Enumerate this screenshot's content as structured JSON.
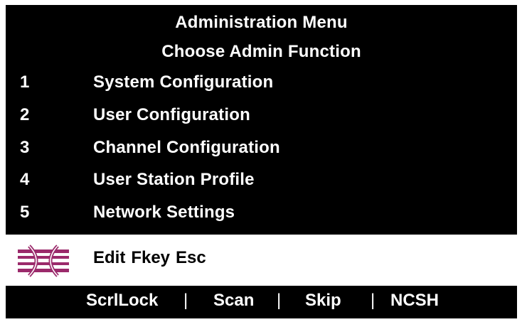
{
  "header": {
    "title": "Administration Menu",
    "subtitle": "Choose Admin Function"
  },
  "menu": {
    "items": [
      {
        "number": "1",
        "label": "System Configuration"
      },
      {
        "number": "2",
        "label": "User Configuration"
      },
      {
        "number": "3",
        "label": "Channel Configuration"
      },
      {
        "number": "4",
        "label": "User Station Profile"
      },
      {
        "number": "5",
        "label": "Network Settings"
      }
    ]
  },
  "status_bar": {
    "logo_icon": "avocent-logo-icon",
    "logo_color": "#9b2a6b",
    "keys": [
      "Edit",
      "Fkey",
      "Esc"
    ]
  },
  "footer": {
    "items": [
      "ScrlLock",
      "Scan",
      "Skip",
      "NCSH"
    ],
    "separator": "|"
  },
  "colors": {
    "background": "#000000",
    "text": "#ffffff",
    "status_bar_bg": "#ffffff",
    "status_bar_text": "#000000"
  }
}
